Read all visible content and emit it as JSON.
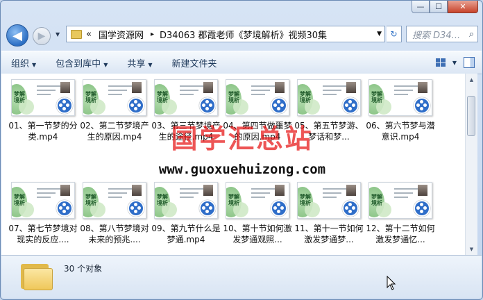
{
  "window": {
    "controls": {
      "minimize": "—",
      "maximize": "☐",
      "close": "✕"
    }
  },
  "nav": {
    "back_icon": "◀",
    "forward_icon": "▶",
    "dropdown_icon": "▼",
    "breadcrumb_overflow": "«",
    "breadcrumb": [
      "国学资源网",
      "D34063 郡霞老师《梦境解析》视频30集"
    ],
    "separator": "▸",
    "address_dropdown": "▼",
    "refresh_icon": "↻",
    "search_placeholder": "搜索 D34...",
    "search_icon": "⌕"
  },
  "toolbar": {
    "organize": "组织",
    "include_in_library": "包含到库中",
    "share": "共享",
    "new_folder": "新建文件夹",
    "caret": "▼"
  },
  "files": [
    {
      "label": "01、第一节梦的分类.mp4"
    },
    {
      "label": "02、第二节梦境产生的原因.mp4"
    },
    {
      "label": "03、第三节梦境产生的途径.mp4"
    },
    {
      "label": "04、第四节做噩梦的原因.mp4"
    },
    {
      "label": "05、第五节梦游、梦话和梦..."
    },
    {
      "label": "06、第六节梦与潜意识.mp4"
    },
    {
      "label": "07、第七节梦境对现实的反应...."
    },
    {
      "label": "08、第八节梦境对未来的预兆...."
    },
    {
      "label": "09、第九节什么是梦通.mp4"
    },
    {
      "label": "10、第十节如何激发梦通观照..."
    },
    {
      "label": "11、第十一节如何激发梦通梦..."
    },
    {
      "label": "12、第十二节如何激发梦通忆..."
    }
  ],
  "thumb_title": "梦解境析",
  "watermark": {
    "cn": "国学汇总站",
    "url": "www.guoxuehuizong.com"
  },
  "scrollbar": {
    "up": "▲",
    "down": "▼"
  },
  "details": {
    "count": "30 个对象"
  },
  "colors": {
    "reel": "#2f6ec9",
    "watermark": "#e61414",
    "leaf": "#6fb56a"
  }
}
